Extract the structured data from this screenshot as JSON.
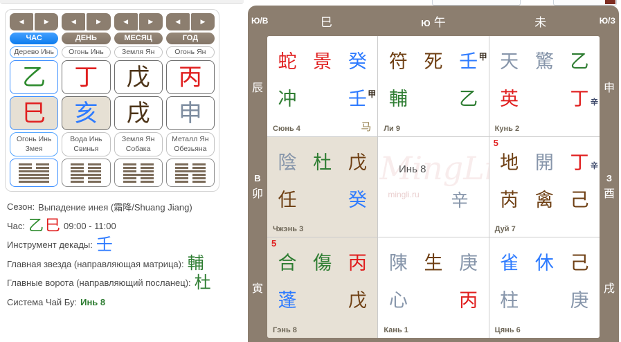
{
  "palette": {
    "red": "#e01e1e",
    "green": "#2e7d32",
    "blue": "#2e7bff",
    "brown": "#6f4014",
    "gray": "#8695aa",
    "dark": "#3c3022",
    "navy": "#3a4668",
    "taupe": "#8c7e6f",
    "accent_blue": "#1e8fff",
    "shaded_bg": "#e7e1d6"
  },
  "left_panel": {
    "columns": [
      {
        "id": "hour",
        "tab": "ЧАС",
        "active": true,
        "element": "Дерево Инь",
        "stem": {
          "char": "乙",
          "color": "#2e8b2e"
        },
        "branch": {
          "char": "巳",
          "color": "#e02020",
          "shaded": true
        },
        "animal_line1": "Огонь Инь",
        "animal_line2": "Змея",
        "hexagram": [
          "broken",
          "broken",
          "solid",
          "solid",
          "solid",
          "solid"
        ]
      },
      {
        "id": "day",
        "tab": "ДЕНЬ",
        "active": false,
        "element": "Огонь Инь",
        "stem": {
          "char": "丁",
          "color": "#e02020"
        },
        "branch": {
          "char": "亥",
          "color": "#2e7bff",
          "shaded": true
        },
        "animal_line1": "Вода Инь",
        "animal_line2": "Свинья",
        "hexagram": [
          "broken",
          "broken",
          "broken",
          "solid",
          "broken",
          "broken"
        ]
      },
      {
        "id": "month",
        "tab": "МЕСЯЦ",
        "active": false,
        "element": "Земля Ян",
        "stem": {
          "char": "戊",
          "color": "#4d3418"
        },
        "branch": {
          "char": "戌",
          "color": "#4d3418",
          "shaded": false
        },
        "animal_line1": "Земля Ян",
        "animal_line2": "Собака",
        "hexagram": [
          "broken",
          "broken",
          "broken",
          "solid",
          "broken",
          "broken"
        ]
      },
      {
        "id": "year",
        "tab": "ГОД",
        "active": false,
        "element": "Огонь Ян",
        "stem": {
          "char": "丙",
          "color": "#e02020"
        },
        "branch": {
          "char": "申",
          "color": "#7e8da0",
          "shaded": false
        },
        "animal_line1": "Металл Ян",
        "animal_line2": "Обезьяна",
        "hexagram": [
          "broken",
          "broken",
          "solid",
          "broken",
          "broken",
          "broken"
        ]
      }
    ]
  },
  "info": {
    "season_label": "Сезон:",
    "season_value": "Выпадение инея (霜降/Shuang Jiang)",
    "hour_label": "Час:",
    "hour_stem": "乙",
    "hour_branch": "巳",
    "hour_time": "09:00 - 11:00",
    "decade_label": "Инструмент декады:",
    "decade_value": "壬",
    "star_label": "Главная звезда (направляющая матрица):",
    "star_value": "輔",
    "gate_label": "Главные ворота (направляющий посланец):",
    "gate_value": "杜",
    "system_label": "Система Чай Бу:",
    "system_value": "Инь 8"
  },
  "grid": {
    "top": {
      "left_corner": "Ю/В",
      "c1": "巳",
      "c2_dir": "Ю",
      "c2_branch": "午",
      "c3": "未",
      "right_corner": "Ю/З"
    },
    "left_side": {
      "r1": "辰",
      "r2_dir": "В",
      "r2_branch": "卯",
      "r3": "寅"
    },
    "right_side": {
      "r1": "申",
      "r2_dir": "З",
      "r2_branch": "酉",
      "r3": "戌"
    },
    "palaces": [
      {
        "id": "xun4",
        "name": "Сюнь 4",
        "shaded": false,
        "badge": "",
        "corner": "马",
        "row1": [
          {
            "t": "蛇",
            "c": "red"
          },
          {
            "t": "景",
            "c": "red"
          },
          {
            "t": "癸",
            "c": "blue"
          }
        ],
        "row2": [
          {
            "t": "冲",
            "c": "green"
          },
          {
            "t": "",
            "c": ""
          },
          {
            "t": "壬",
            "c": "blue",
            "mark": "甲",
            "markpos": "sup",
            "markc": "dark"
          }
        ]
      },
      {
        "id": "li9",
        "name": "Ли 9",
        "shaded": false,
        "badge": "",
        "corner": "",
        "row1": [
          {
            "t": "符",
            "c": "brown"
          },
          {
            "t": "死",
            "c": "brown"
          },
          {
            "t": "壬",
            "c": "blue",
            "mark": "甲",
            "markpos": "sup",
            "markc": "dark"
          }
        ],
        "row2": [
          {
            "t": "輔",
            "c": "green"
          },
          {
            "t": "",
            "c": ""
          },
          {
            "t": "乙",
            "c": "green"
          }
        ]
      },
      {
        "id": "kun2",
        "name": "Кунь 2",
        "shaded": false,
        "badge": "",
        "corner": "",
        "row1": [
          {
            "t": "天",
            "c": "gray"
          },
          {
            "t": "驚",
            "c": "gray"
          },
          {
            "t": "乙",
            "c": "green"
          }
        ],
        "row2": [
          {
            "t": "英",
            "c": "red"
          },
          {
            "t": "",
            "c": ""
          },
          {
            "t": "丁",
            "c": "red",
            "mark": "辛",
            "markpos": "sub",
            "markc": "navy"
          }
        ]
      },
      {
        "id": "zhen3",
        "name": "Чжэнь 3",
        "shaded": true,
        "badge": "",
        "corner": "",
        "row1": [
          {
            "t": "陰",
            "c": "gray"
          },
          {
            "t": "杜",
            "c": "green"
          },
          {
            "t": "戊",
            "c": "brown"
          }
        ],
        "row2": [
          {
            "t": "任",
            "c": "brown"
          },
          {
            "t": "",
            "c": ""
          },
          {
            "t": "癸",
            "c": "blue"
          }
        ]
      },
      {
        "id": "center",
        "center": true,
        "title": "Инь 8",
        "corner_char": "辛",
        "watermark_script": "MingLi",
        "watermark_url": "mingli.ru"
      },
      {
        "id": "dui7",
        "name": "Дуй 7",
        "shaded": false,
        "badge": "5",
        "corner": "",
        "row1": [
          {
            "t": "地",
            "c": "brown"
          },
          {
            "t": "開",
            "c": "gray"
          },
          {
            "t": "丁",
            "c": "red",
            "mark": "辛",
            "markpos": "sub",
            "markc": "navy"
          }
        ],
        "row2": [
          {
            "t": "芮",
            "c": "brown"
          },
          {
            "t": "禽",
            "c": "brown"
          },
          {
            "t": "己",
            "c": "brown"
          }
        ]
      },
      {
        "id": "gen8",
        "name": "Гэнь 8",
        "shaded": true,
        "badge": "5",
        "corner": "",
        "row1": [
          {
            "t": "合",
            "c": "green"
          },
          {
            "t": "傷",
            "c": "green"
          },
          {
            "t": "丙",
            "c": "red"
          }
        ],
        "row2": [
          {
            "t": "蓬",
            "c": "blue"
          },
          {
            "t": "",
            "c": ""
          },
          {
            "t": "戊",
            "c": "brown"
          }
        ]
      },
      {
        "id": "kan1",
        "name": "Кань 1",
        "shaded": false,
        "badge": "",
        "corner": "",
        "row1": [
          {
            "t": "陳",
            "c": "gray"
          },
          {
            "t": "生",
            "c": "brown"
          },
          {
            "t": "庚",
            "c": "gray"
          }
        ],
        "row2": [
          {
            "t": "心",
            "c": "gray"
          },
          {
            "t": "",
            "c": ""
          },
          {
            "t": "丙",
            "c": "red"
          }
        ]
      },
      {
        "id": "qian6",
        "name": "Цянь 6",
        "shaded": false,
        "badge": "",
        "corner": "",
        "row1": [
          {
            "t": "雀",
            "c": "blue"
          },
          {
            "t": "休",
            "c": "blue"
          },
          {
            "t": "己",
            "c": "brown"
          }
        ],
        "row2": [
          {
            "t": "柱",
            "c": "gray"
          },
          {
            "t": "",
            "c": ""
          },
          {
            "t": "庚",
            "c": "gray"
          }
        ]
      }
    ]
  }
}
